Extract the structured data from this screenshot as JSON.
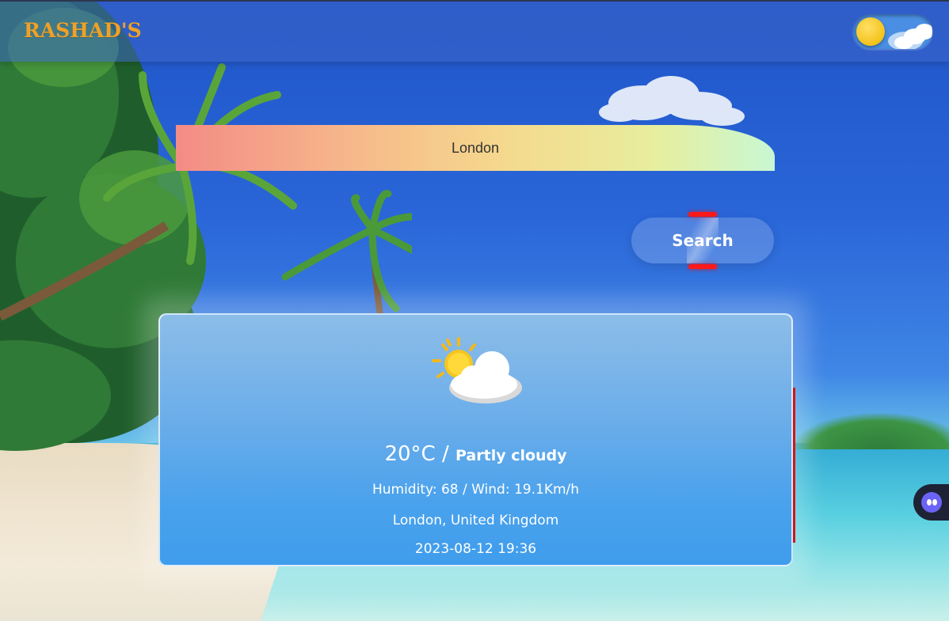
{
  "header": {
    "logo_text": "RASHAD'S",
    "theme_toggle_icon": "sun-toggle-icon"
  },
  "search": {
    "input_value": "London",
    "button_label": "Search"
  },
  "weather": {
    "icon": "partly-cloudy-icon",
    "temperature": "20°C",
    "separator": " / ",
    "condition": "Partly cloudy",
    "details": "Humidity: 68 / Wind: 19.1Km/h",
    "location": "London, United Kingdom",
    "datetime": "2023-08-12 19:36"
  },
  "side_widget": {
    "icon": "assistant-face-icon"
  },
  "colors": {
    "logo": "#f0a125",
    "search_accent": "#ff1a1a",
    "card_edge": "#d11616"
  }
}
